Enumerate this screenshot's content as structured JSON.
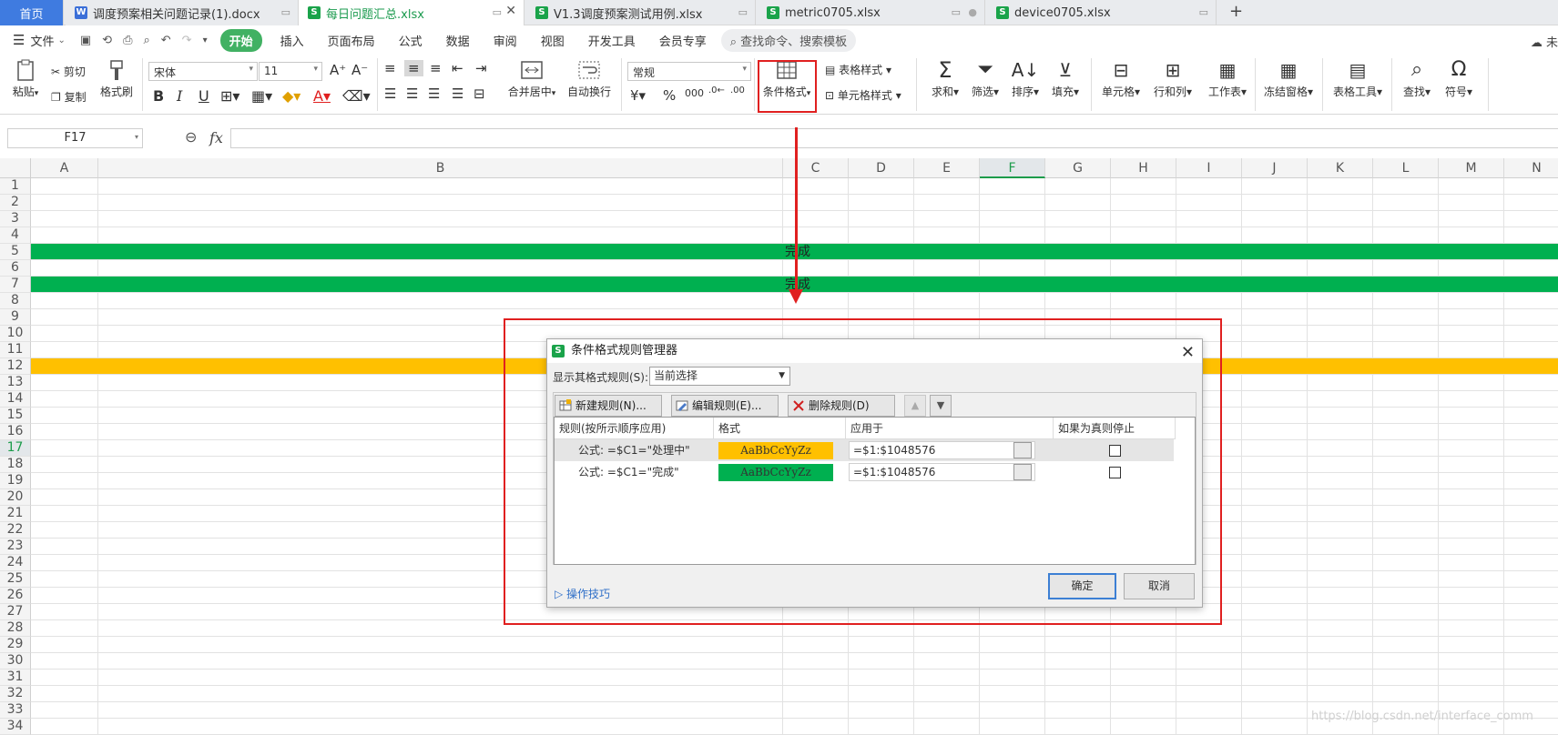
{
  "tabs": [
    {
      "label": "首页",
      "icon": ""
    },
    {
      "label": "调度预案相关问题记录(1).docx",
      "icon": "W"
    },
    {
      "label": "每日问题汇总.xlsx",
      "icon": "S"
    },
    {
      "label": "V1.3调度预案测试用例.xlsx",
      "icon": "S"
    },
    {
      "label": "metric0705.xlsx",
      "icon": "S"
    },
    {
      "label": "device0705.xlsx",
      "icon": "S"
    }
  ],
  "new_tab": "+",
  "menu": {
    "file": "文件",
    "start": "开始",
    "items": [
      "插入",
      "页面布局",
      "公式",
      "数据",
      "审阅",
      "视图",
      "开发工具",
      "会员专享"
    ],
    "search": "查找命令、搜索模板",
    "right": "未"
  },
  "ribbon": {
    "paste": "粘贴",
    "cut": "剪切",
    "copy": "复制",
    "format_painter": "格式刷",
    "font_name": "宋体",
    "font_size": "11",
    "bold": "B",
    "italic": "I",
    "underline": "U",
    "merge": "合并居中",
    "wrap": "自动换行",
    "number_format": "常规",
    "cond_format": "条件格式",
    "table_style": "表格样式",
    "cell_style": "单元格样式",
    "sum": "求和",
    "filter": "筛选",
    "sort": "排序",
    "fill": "填充",
    "cell": "单元格",
    "rowcol": "行和列",
    "worksheet": "工作表",
    "freeze": "冻结窗格",
    "table_tools": "表格工具",
    "find": "查找",
    "symbol": "符号"
  },
  "formula_bar": {
    "cell_ref": "F17",
    "fx": "fx",
    "value": ""
  },
  "columns": [
    "A",
    "B",
    "C",
    "D",
    "E",
    "F",
    "G",
    "H",
    "I",
    "J",
    "K",
    "L",
    "M",
    "N"
  ],
  "selected_column": "F",
  "rows": [
    "1",
    "2",
    "3",
    "4",
    "5",
    "6",
    "7",
    "8",
    "9",
    "10",
    "11",
    "12",
    "13",
    "14",
    "15",
    "16",
    "17",
    "18",
    "19",
    "20",
    "21",
    "22",
    "23",
    "24",
    "25",
    "26",
    "27",
    "28",
    "29",
    "30",
    "31",
    "32",
    "33",
    "34"
  ],
  "selected_row": "17",
  "cells": {
    "c5": "完成",
    "c7": "完成"
  },
  "colors": {
    "green": "#00b050",
    "yellow": "#ffc000",
    "accent": "#1c9c4b",
    "annotation": "#e02020"
  },
  "dialog": {
    "title": "条件格式规则管理器",
    "show_rules_label": "显示其格式规则(S):",
    "show_rules_value": "当前选择",
    "new_rule": "新建规则(N)...",
    "edit_rule": "编辑规则(E)...",
    "delete_rule": "删除规则(D)",
    "headers": {
      "rule": "规则(按所示顺序应用)",
      "format": "格式",
      "applies_to": "应用于",
      "stop_if_true": "如果为真则停止"
    },
    "rules": [
      {
        "formula": "公式: =$C1=\"处理中\"",
        "preview": "AaBbCcYyZz",
        "preview_color": "#ffc000",
        "applies_to": "=$1:$1048576",
        "stop": false
      },
      {
        "formula": "公式: =$C1=\"完成\"",
        "preview": "AaBbCcYyZz",
        "preview_color": "#00b050",
        "applies_to": "=$1:$1048576",
        "stop": false
      }
    ],
    "tips": "操作技巧",
    "ok": "确定",
    "cancel": "取消"
  },
  "watermark": "https://blog.csdn.net/interface_comm"
}
